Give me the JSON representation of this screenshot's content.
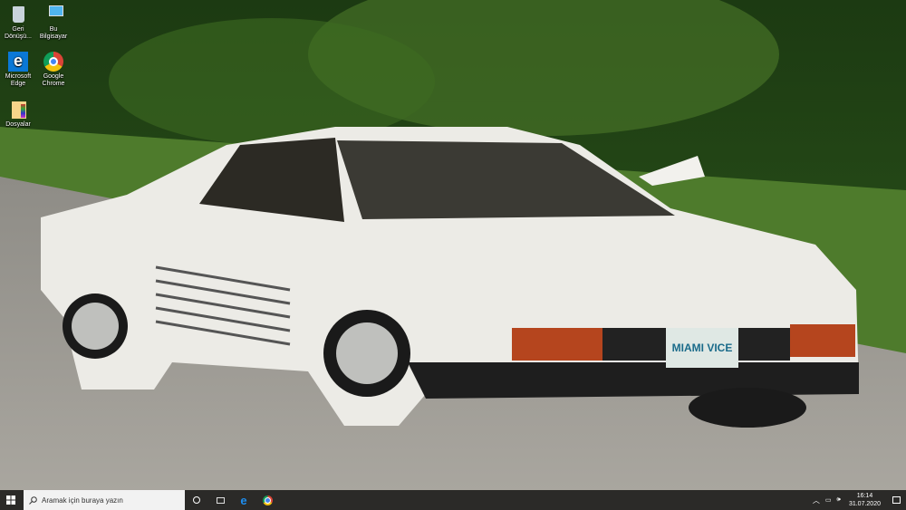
{
  "desktop": {
    "icons": [
      {
        "label": "Geri Dönüşü...",
        "icon": "recycle-bin-icon"
      },
      {
        "label": "Bu Bilgisayar",
        "icon": "this-pc-icon"
      },
      {
        "label": "Microsoft Edge",
        "icon": "edge-icon"
      },
      {
        "label": "Google Chrome",
        "icon": "chrome-icon"
      },
      {
        "label": "Dosyalar",
        "icon": "folder-icon"
      }
    ]
  },
  "wallpaper": {
    "plate_text": "MIAMI VICE"
  },
  "taskbar": {
    "search_placeholder": "Aramak için buraya yazın",
    "time": "16:14",
    "date": "31.07.2020"
  },
  "colors": {
    "taskbar": "#2b2a28",
    "edge": "#0a78d7"
  }
}
